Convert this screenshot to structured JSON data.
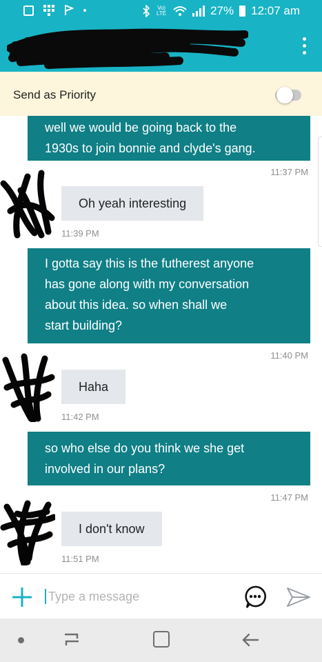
{
  "status_bar": {
    "volte_label": "Vo) LTE",
    "battery_percent": "27%",
    "time": "12:07 am"
  },
  "priority": {
    "label": "Send as Priority",
    "enabled": false
  },
  "messages": [
    {
      "direction": "outgoing",
      "lines": [
        "well we would be going back to the",
        "1930s to join bonnie and clyde's gang."
      ],
      "time": "11:37 PM"
    },
    {
      "direction": "incoming",
      "text": "Oh yeah interesting",
      "time": "11:39 PM"
    },
    {
      "direction": "outgoing",
      "lines": [
        "I gotta say this is the futherest anyone",
        "has gone along with my conversation",
        "about this idea. so when shall we",
        "start building?"
      ],
      "time": "11:40 PM"
    },
    {
      "direction": "incoming",
      "text": "Haha",
      "time": "11:42 PM"
    },
    {
      "direction": "outgoing",
      "lines": [
        "so who else do you think we she get",
        "involved in our plans?"
      ],
      "time": "11:47 PM"
    },
    {
      "direction": "incoming",
      "text": "I don't know",
      "time": "11:51 PM"
    }
  ],
  "composer": {
    "placeholder": "Type a message",
    "value": ""
  },
  "colors": {
    "header": "#18b3c5",
    "outgoing_bubble": "#107f86",
    "incoming_bubble": "#e4e7ec",
    "priority_bar": "#fdf5dc"
  },
  "icons": [
    "facebook-icon",
    "grid-icon",
    "flag-icon",
    "bluetooth-icon",
    "wifi-icon",
    "signal-icon",
    "battery-icon",
    "more-options-icon",
    "plus-icon",
    "emoji-icon",
    "send-icon",
    "recent-apps-icon",
    "home-icon",
    "back-icon"
  ]
}
